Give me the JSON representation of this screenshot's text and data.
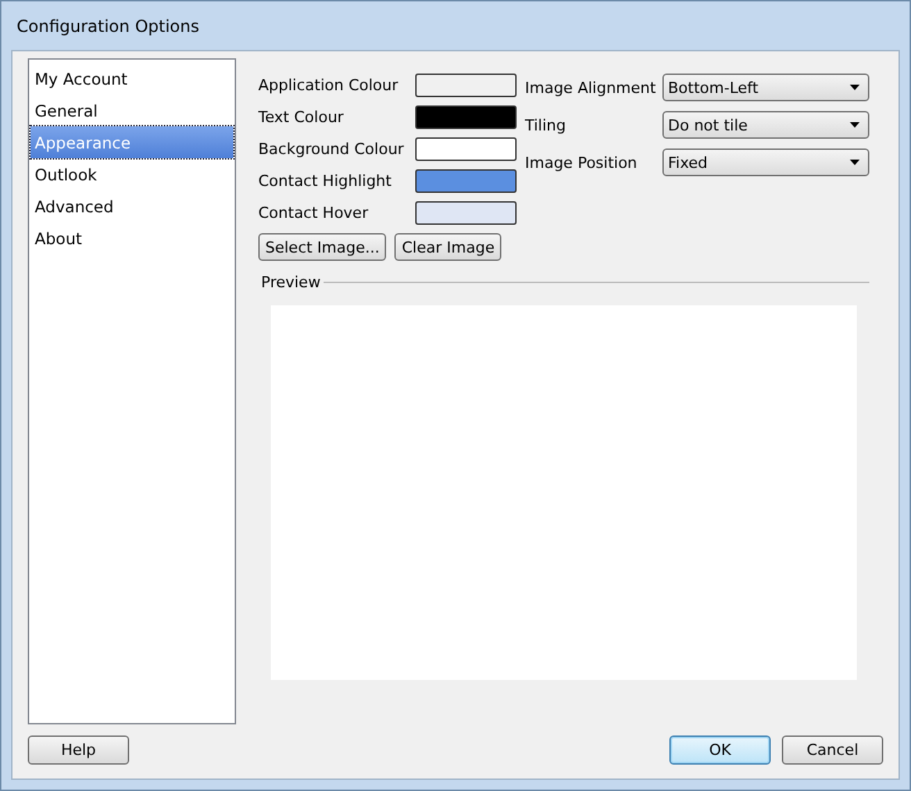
{
  "window": {
    "title": "Configuration Options"
  },
  "sidebar": {
    "items": [
      {
        "label": "My Account",
        "selected": false
      },
      {
        "label": "General",
        "selected": false
      },
      {
        "label": "Appearance",
        "selected": true
      },
      {
        "label": "Outlook",
        "selected": false
      },
      {
        "label": "Advanced",
        "selected": false
      },
      {
        "label": "About",
        "selected": false
      }
    ]
  },
  "colours": [
    {
      "label": "Application Colour",
      "color": "#f0f0f0"
    },
    {
      "label": "Text Colour",
      "color": "#000000"
    },
    {
      "label": "Background Colour",
      "color": "#ffffff"
    },
    {
      "label": "Contact Highlight",
      "color": "#5b8fe0"
    },
    {
      "label": "Contact Hover",
      "color": "#dfe6f4"
    }
  ],
  "options": [
    {
      "label": "Image Alignment",
      "value": "Bottom-Left"
    },
    {
      "label": "Tiling",
      "value": "Do not tile"
    },
    {
      "label": "Image Position",
      "value": "Fixed"
    }
  ],
  "image_buttons": [
    "Select Image...",
    "Clear Image"
  ],
  "preview": {
    "label": "Preview"
  },
  "footer": {
    "help": "Help",
    "buttons": [
      {
        "label": "OK",
        "default": true
      },
      {
        "label": "Cancel",
        "default": false
      }
    ]
  }
}
